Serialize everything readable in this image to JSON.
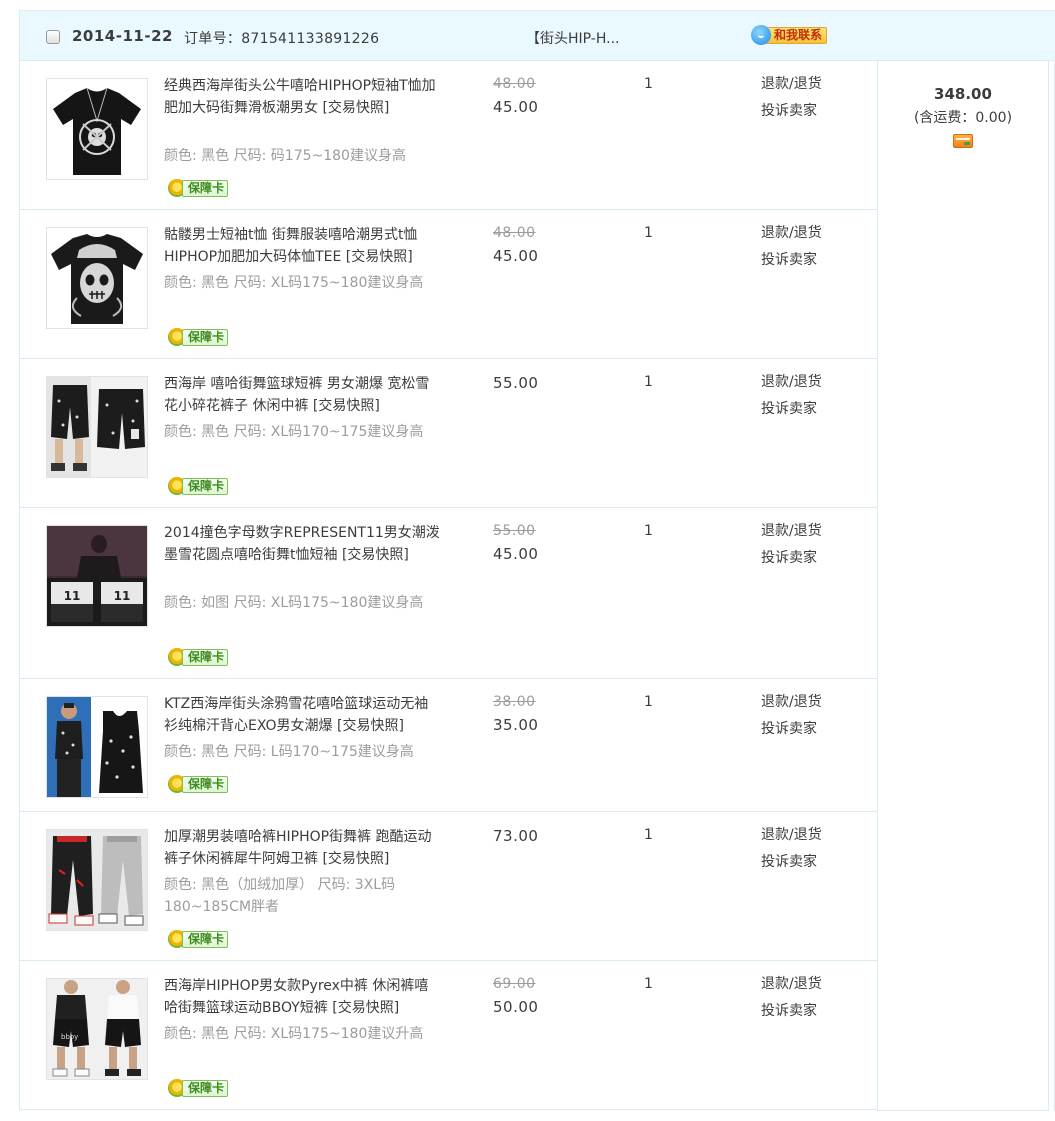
{
  "order": {
    "date": "2014-11-22",
    "number_label": "订单号：871541133891226",
    "shop_name": "【街头HIP-H...",
    "contact_label": "和我联系",
    "total": "348.00",
    "shipping": "(含运费：0.00)"
  },
  "actions": {
    "refund": "退款/退货",
    "complain": "投诉卖家",
    "guarantee": "保障卡"
  },
  "items": [
    {
      "title": "经典西海岸街头公牛嘻哈HIPHOP短袖T恤加肥加大码街舞滑板潮男女",
      "snapshot": "[交易快照]",
      "spec": "颜色: 黑色  尺码: 码175~180建议身高",
      "price_original": "48.00",
      "price": "45.00",
      "qty": "1"
    },
    {
      "title": "骷髅男士短袖t恤 街舞服装嘻哈潮男式t恤HIPHOP加肥加大码体恤TEE",
      "snapshot": "[交易快照]",
      "spec": "颜色: 黑色  尺码: XL码175~180建议身高",
      "price_original": "48.00",
      "price": "45.00",
      "qty": "1"
    },
    {
      "title": "西海岸 嘻哈街舞篮球短裤 男女潮爆 宽松雪花小碎花裤子 休闲中裤",
      "snapshot": "[交易快照]",
      "spec": "颜色: 黑色  尺码: XL码170~175建议身高",
      "price_original": "",
      "price": "55.00",
      "qty": "1"
    },
    {
      "title": "2014撞色字母数字REPRESENT11男女潮泼墨雪花圆点嘻哈街舞t恤短袖",
      "snapshot": "[交易快照]",
      "spec": "颜色: 如图  尺码: XL码175~180建议身高",
      "price_original": "55.00",
      "price": "45.00",
      "qty": "1"
    },
    {
      "title": "KTZ西海岸街头涂鸦雪花嘻哈篮球运动无袖衫纯棉汗背心EXO男女潮爆",
      "snapshot": "[交易快照]",
      "spec": "颜色: 黑色  尺码: L码170~175建议身高",
      "price_original": "38.00",
      "price": "35.00",
      "qty": "1"
    },
    {
      "title": "加厚潮男装嘻哈裤HIPHOP街舞裤 跑酷运动裤子休闲裤犀牛阿姆卫裤",
      "snapshot": "[交易快照]",
      "spec": "颜色: 黑色（加绒加厚）  尺码: 3XL码180~185CM胖者",
      "price_original": "",
      "price": "73.00",
      "qty": "1"
    },
    {
      "title": "西海岸HIPHOP男女款Pyrex中裤 休闲裤嘻哈街舞篮球运动BBOY短裤",
      "snapshot": "[交易快照]",
      "spec": "颜色: 黑色  尺码: XL码175~180建议升高",
      "price_original": "69.00",
      "price": "50.00",
      "qty": "1"
    }
  ]
}
